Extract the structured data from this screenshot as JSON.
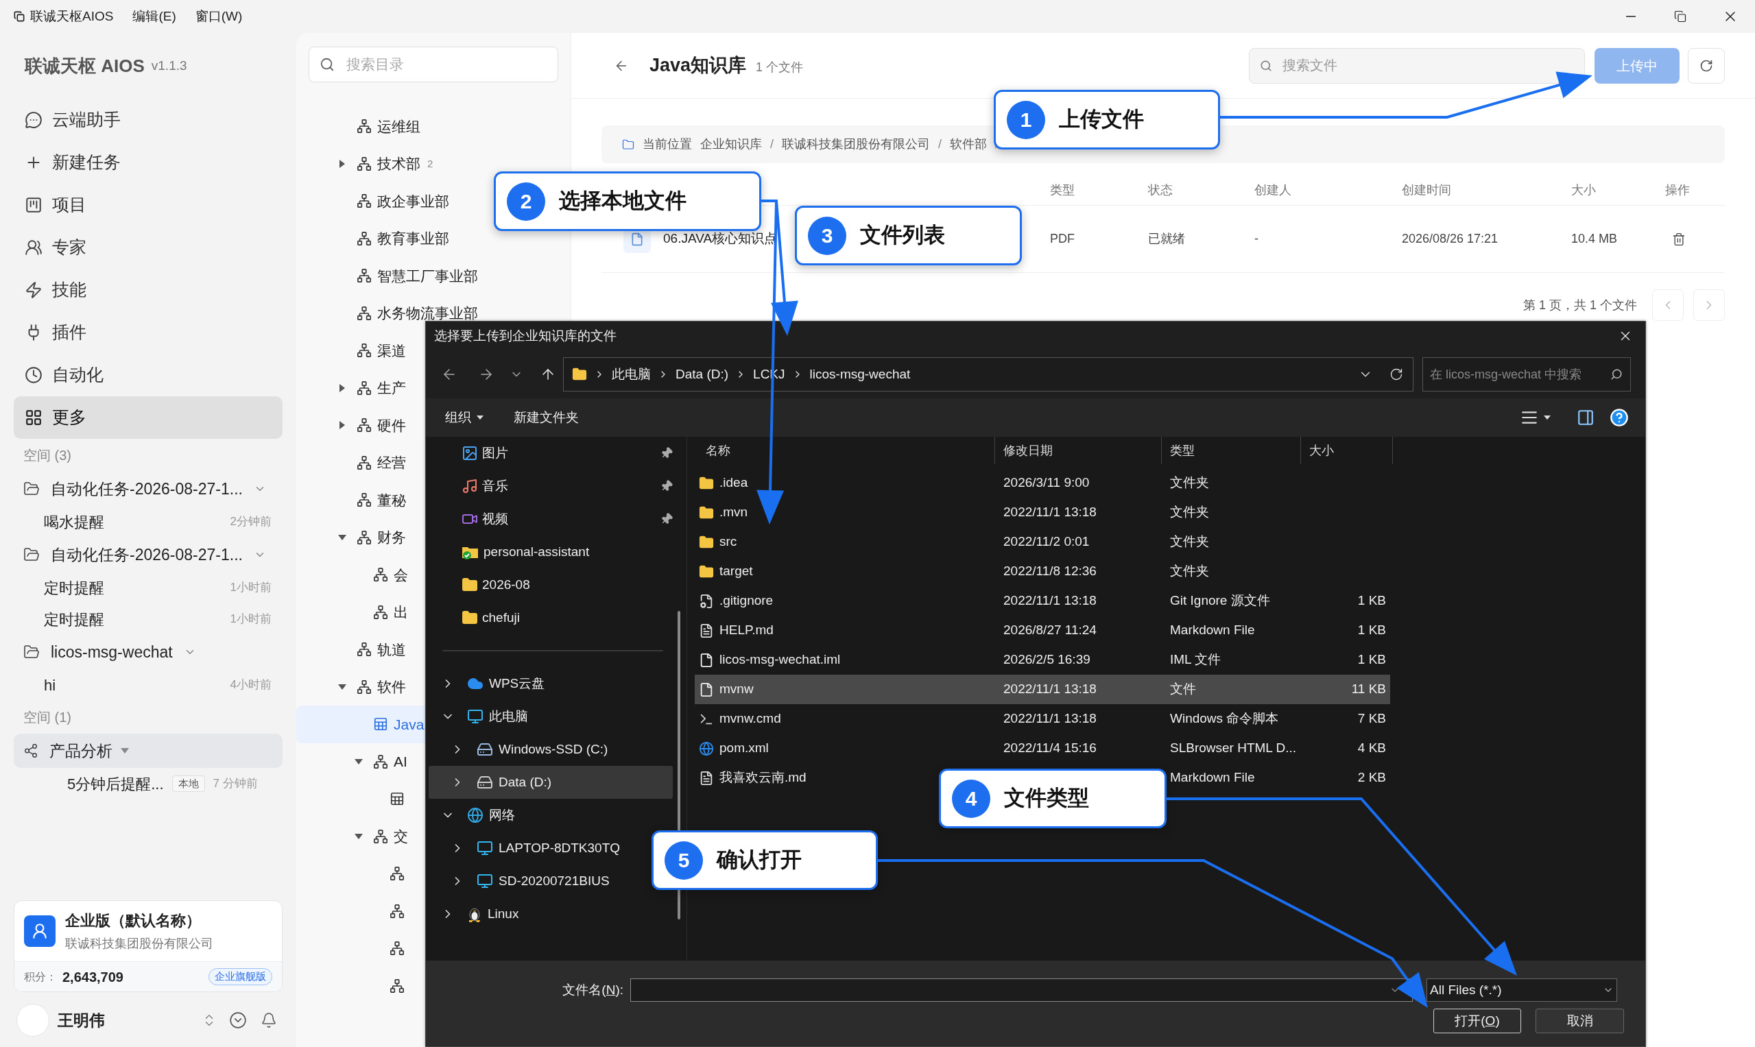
{
  "titlebar": {
    "app": "联诚天枢AIOS",
    "menus": [
      "编辑(E)",
      "窗口(W)"
    ]
  },
  "sidebar": {
    "brand": "联诚天枢 AIOS",
    "version": "v1.1.3",
    "nav": [
      {
        "kind": "assistant",
        "label": "云端助手",
        "selected": false
      },
      {
        "kind": "new",
        "label": "新建任务",
        "selected": false
      },
      {
        "kind": "project",
        "label": "项目",
        "selected": false
      },
      {
        "kind": "expert",
        "label": "专家",
        "selected": false
      },
      {
        "kind": "skill",
        "label": "技能",
        "selected": false
      },
      {
        "kind": "plugin",
        "label": "插件",
        "selected": false
      },
      {
        "kind": "automation",
        "label": "自动化",
        "selected": false
      },
      {
        "kind": "more",
        "label": "更多",
        "selected": true
      }
    ],
    "spaces": [
      {
        "heading": "空间 (3)",
        "groups": [
          {
            "kind": "folder",
            "name": "自动化任务-2026-08-27-1...",
            "items": [
              {
                "name": "喝水提醒",
                "time": "2分钟前"
              }
            ]
          },
          {
            "kind": "folder",
            "name": "自动化任务-2026-08-27-1...",
            "items": [
              {
                "name": "定时提醒",
                "time": "1小时前"
              },
              {
                "name": "定时提醒",
                "time": "1小时前"
              }
            ]
          },
          {
            "kind": "folder",
            "name": "licos-msg-wechat",
            "items": [
              {
                "name": "hi",
                "time": "4小时前"
              }
            ]
          }
        ]
      },
      {
        "heading": "空间 (1)",
        "groups": [
          {
            "kind": "share",
            "name": "产品分析",
            "items": [
              {
                "name": "5分钟后提醒...",
                "tag": "本地",
                "time": "7 分钟前"
              }
            ]
          }
        ]
      }
    ],
    "plan_card": {
      "title": "企业版（默认名称）",
      "company": "联诚科技集团股份有限公司",
      "points_label": "积分：",
      "points": "2,643,709",
      "badge": "企业旗舰版"
    },
    "user": {
      "name": "王明伟"
    }
  },
  "tree": {
    "search_placeholder": "搜索目录",
    "nodes": [
      {
        "kind": "org",
        "label": "运维组"
      },
      {
        "kind": "org",
        "label": "技术部",
        "count": "2",
        "expanded": false
      },
      {
        "kind": "org",
        "label": "政企事业部"
      },
      {
        "kind": "org",
        "label": "教育事业部"
      },
      {
        "kind": "org",
        "label": "智慧工厂事业部"
      },
      {
        "kind": "org",
        "label": "水务物流事业部"
      },
      {
        "kind": "org",
        "label": "渠道"
      },
      {
        "kind": "org",
        "label": "生产",
        "expanded": false
      },
      {
        "kind": "org",
        "label": "硬件",
        "expanded": false
      },
      {
        "kind": "org",
        "label": "经营"
      },
      {
        "kind": "org",
        "label": "董秘"
      },
      {
        "kind": "org",
        "label": "财务",
        "expanded": true,
        "children": [
          {
            "kind": "org",
            "label": "会"
          },
          {
            "kind": "org",
            "label": "出"
          }
        ]
      },
      {
        "kind": "org",
        "label": "轨道"
      },
      {
        "kind": "org",
        "label": "软件",
        "expanded": true,
        "children": [
          {
            "kind": "doc",
            "label": "Java",
            "selected": true
          },
          {
            "kind": "org",
            "label": "AI",
            "expanded": true,
            "children": [
              {
                "kind": "doc",
                "selected": false
              }
            ]
          },
          {
            "kind": "org",
            "label": "交",
            "expanded": true,
            "children": [
              {
                "kind": "org"
              },
              {
                "kind": "org"
              },
              {
                "kind": "org"
              },
              {
                "kind": "org"
              }
            ]
          }
        ]
      }
    ]
  },
  "knowledge_base": {
    "title": "Java知识库",
    "count": "1 个文件",
    "search_placeholder": "搜索文件",
    "upload_button": {
      "label": "上传中",
      "disabled": true
    },
    "breadcrumb": {
      "label": "当前位置",
      "separator": "/",
      "items": [
        "企业知识库",
        "联诚科技集团股份有限公司",
        "软件部"
      ]
    },
    "columns": [
      "类型",
      "状态",
      "创建人",
      "创建时间",
      "大小",
      "操作"
    ],
    "rows": [
      {
        "name": "06.JAVA核心知识点",
        "type": "PDF",
        "status": "已就绪",
        "creator": "-",
        "created": "2026/08/26 17:21",
        "size": "10.4 MB"
      }
    ],
    "pagination": "第 1 页，共 1 个文件"
  },
  "dialog": {
    "title": "选择要上传到企业知识库的文件",
    "address": [
      "此电脑",
      "Data (D:)",
      "LCKJ",
      "licos-msg-wechat"
    ],
    "search_placeholder": "在 licos-msg-wechat 中搜索",
    "toolbar": {
      "organize": "组织",
      "new_folder": "新建文件夹"
    },
    "quick_access": [
      {
        "kind": "pictures",
        "label": "图片",
        "pinned": true
      },
      {
        "kind": "music",
        "label": "音乐",
        "pinned": true
      },
      {
        "kind": "video",
        "label": "视频",
        "pinned": true
      },
      {
        "kind": "folder-synced",
        "label": "personal-assistant",
        "pinned": false
      },
      {
        "kind": "folder",
        "label": "2026-08",
        "pinned": false
      },
      {
        "kind": "folder",
        "label": "chefuji",
        "pinned": false
      }
    ],
    "nav_tree": [
      {
        "kind": "cloud",
        "label": "WPS云盘",
        "expanded": false,
        "selected": false
      },
      {
        "kind": "computer",
        "label": "此电脑",
        "expanded": true,
        "selected": false,
        "children": [
          {
            "kind": "drive-system",
            "label": "Windows-SSD (C:)",
            "expanded": false,
            "selected": false
          },
          {
            "kind": "drive",
            "label": "Data (D:)",
            "expanded": false,
            "selected": true
          }
        ]
      },
      {
        "kind": "network",
        "label": "网络",
        "expanded": true,
        "selected": false,
        "children": [
          {
            "kind": "monitor",
            "label": "LAPTOP-8DTK30TQ",
            "expanded": false,
            "selected": false
          },
          {
            "kind": "monitor",
            "label": "SD-20200721BIUS",
            "expanded": false,
            "selected": false
          }
        ]
      },
      {
        "kind": "linux",
        "label": "Linux",
        "expanded": false,
        "selected": false
      }
    ],
    "columns": [
      "名称",
      "修改日期",
      "类型",
      "大小"
    ],
    "files": [
      {
        "kind": "folder",
        "name": ".idea",
        "modified": "2026/3/11 9:00",
        "type": "文件夹",
        "selected": false
      },
      {
        "kind": "folder",
        "name": ".mvn",
        "modified": "2022/11/1 13:18",
        "type": "文件夹",
        "selected": false
      },
      {
        "kind": "folder",
        "name": "src",
        "modified": "2022/11/2 0:01",
        "type": "文件夹",
        "selected": false
      },
      {
        "kind": "folder",
        "name": "target",
        "modified": "2022/11/8 12:36",
        "type": "文件夹",
        "selected": false
      },
      {
        "kind": "settings",
        "name": ".gitignore",
        "modified": "2022/11/1 13:18",
        "type": "Git Ignore 源文件",
        "size": "1 KB",
        "selected": false
      },
      {
        "kind": "markdown",
        "name": "HELP.md",
        "modified": "2026/8/27 11:24",
        "type": "Markdown File",
        "size": "1 KB",
        "selected": false
      },
      {
        "kind": "file",
        "name": "licos-msg-wechat.iml",
        "modified": "2026/2/5 16:39",
        "type": "IML 文件",
        "size": "1 KB",
        "selected": false
      },
      {
        "kind": "file",
        "name": "mvnw",
        "modified": "2022/11/1 13:18",
        "type": "文件",
        "size": "11 KB",
        "selected": true
      },
      {
        "kind": "script",
        "name": "mvnw.cmd",
        "modified": "2022/11/1 13:18",
        "type": "Windows 命令脚本",
        "size": "7 KB",
        "selected": false
      },
      {
        "kind": "web",
        "name": "pom.xml",
        "modified": "2022/11/4 15:16",
        "type": "SLBrowser HTML D...",
        "size": "4 KB",
        "selected": false
      },
      {
        "kind": "markdown",
        "name": "我喜欢云南.md",
        "type": "Markdown File",
        "size": "2 KB",
        "selected": false
      }
    ],
    "filename_label": {
      "before": "文件名(",
      "key": "N",
      "after": "):"
    },
    "filter": "All Files (*.*)",
    "open_button": {
      "before": "打开(",
      "key": "O",
      "after": ")"
    },
    "cancel_button": "取消"
  },
  "callouts": [
    {
      "number": "1",
      "label": "上传文件"
    },
    {
      "number": "2",
      "label": "选择本地文件"
    },
    {
      "number": "3",
      "label": "文件列表"
    },
    {
      "number": "4",
      "label": "文件类型"
    },
    {
      "number": "5",
      "label": "确认打开"
    }
  ]
}
